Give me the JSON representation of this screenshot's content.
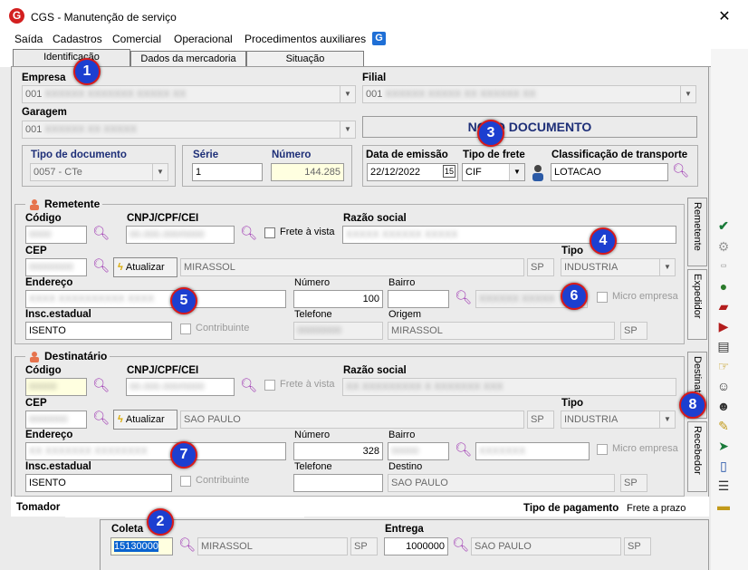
{
  "window": {
    "title": "CGS - Manutenção de serviço",
    "close": "✕"
  },
  "menu": [
    "Saída",
    "Cadastros",
    "Comercial",
    "Operacional",
    "Procedimentos auxiliares"
  ],
  "menu_g_icon": "G",
  "tabs": [
    "Identificação",
    "Dados da mercadoria",
    "Situação"
  ],
  "empresa": {
    "label": "Empresa",
    "value": "001"
  },
  "filial": {
    "label": "Filial",
    "value": "001"
  },
  "garagem": {
    "label": "Garagem",
    "value": "001"
  },
  "status_text": "NOVO DOCUMENTO",
  "tipo_documento": {
    "label": "Tipo de documento",
    "value": "0057 - CTe"
  },
  "serie": {
    "label": "Série",
    "value": "1"
  },
  "numero_doc": {
    "label": "Número",
    "value": "144.285"
  },
  "data_emissao": {
    "label": "Data de emissão",
    "value": "22/12/2022"
  },
  "tipo_frete": {
    "label": "Tipo de frete",
    "value": "CIF"
  },
  "classificacao": {
    "label": "Classificação de transporte",
    "value": "LOTACAO"
  },
  "remetente": {
    "title": "Remetente",
    "codigo_label": "Código",
    "cnpj_label": "CNPJ/CPF/CEI",
    "frete_vista": "Frete à vista",
    "razao_label": "Razão social",
    "cep_label": "CEP",
    "atualizar": "Atualizar",
    "cidade": "MIRASSOL",
    "uf": "SP",
    "tipo_label": "Tipo",
    "tipo": "INDUSTRIA",
    "endereco_label": "Endereço",
    "numero_label": "Número",
    "numero": "100",
    "bairro_label": "Bairro",
    "micro_empresa": "Micro empresa",
    "insc_label": "Insc.estadual",
    "insc": "ISENTO",
    "contribuinte": "Contribuinte",
    "telefone_label": "Telefone",
    "origem_label": "Origem",
    "origem": "MIRASSOL",
    "origem_uf": "SP"
  },
  "destinatario": {
    "title": "Destinatário",
    "codigo_label": "Código",
    "cnpj_label": "CNPJ/CPF/CEI",
    "frete_vista": "Frete à vista",
    "razao_label": "Razão social",
    "cep_label": "CEP",
    "atualizar": "Atualizar",
    "cidade": "SAO PAULO",
    "uf": "SP",
    "tipo_label": "Tipo",
    "tipo": "INDUSTRIA",
    "endereco_label": "Endereço",
    "numero_label": "Número",
    "numero": "328",
    "bairro_label": "Bairro",
    "micro_empresa": "Micro empresa",
    "insc_label": "Insc.estadual",
    "insc": "ISENTO",
    "contribuinte": "Contribuinte",
    "telefone_label": "Telefone",
    "destino_label": "Destino",
    "destino": "SAO PAULO",
    "destino_uf": "SP"
  },
  "side_tabs": [
    "Remetente",
    "Expedidor",
    "Destinatário",
    "Recebedor"
  ],
  "tomador_label": "Tomador",
  "tipo_pagamento_label": "Tipo de pagamento",
  "tipo_pagamento": "Frete a prazo",
  "coleta": {
    "label": "Coleta",
    "cep": "15130000",
    "cidade": "MIRASSOL",
    "uf": "SP"
  },
  "entrega": {
    "label": "Entrega",
    "cep": "1000000",
    "cidade": "SAO PAULO",
    "uf": "SP"
  },
  "badges": [
    "1",
    "2",
    "3",
    "4",
    "5",
    "6",
    "7",
    "8"
  ],
  "colors": {
    "badge_fill": "#1c3fd0",
    "badge_ring": "#d91a1a",
    "status_text": "#1e2f78",
    "accent_magnify": "#a23fb5"
  }
}
